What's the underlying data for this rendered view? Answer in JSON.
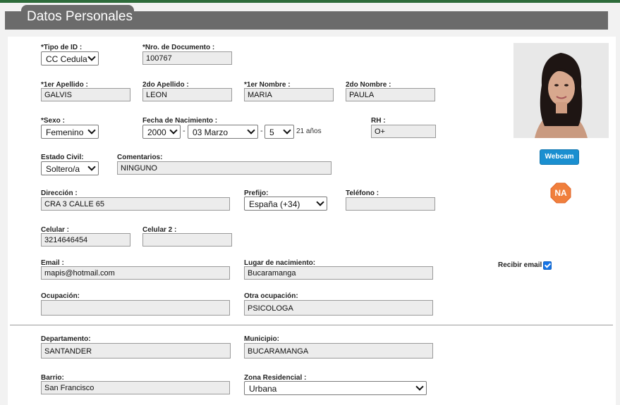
{
  "header": {
    "title": "Datos Personales"
  },
  "fields": {
    "tipo_id": {
      "label": "*Tipo de ID :",
      "value": "CC Cedula"
    },
    "nro_documento": {
      "label": "*Nro. de Documento :",
      "value": "100767"
    },
    "primer_apellido": {
      "label": "*1er Apellido :",
      "value": "GALVIS"
    },
    "segundo_apellido": {
      "label": "2do Apellido :",
      "value": "LEON"
    },
    "primer_nombre": {
      "label": "*1er Nombre :",
      "value": "MARIA"
    },
    "segundo_nombre": {
      "label": "2do Nombre :",
      "value": "PAULA"
    },
    "sexo": {
      "label": "*Sexo :",
      "value": "Femenino"
    },
    "fecha_nacimiento": {
      "label": "Fecha de Nacimiento :",
      "year": "2000",
      "month": "03 Marzo",
      "day": "5",
      "separator": "-",
      "age": "21 años"
    },
    "rh": {
      "label": "RH :",
      "value": "O+"
    },
    "estado_civil": {
      "label": "Estado Civil:",
      "value": "Soltero/a"
    },
    "comentarios": {
      "label": "Comentarios:",
      "value": "NINGUNO"
    },
    "direccion": {
      "label": "Dirección :",
      "value": "CRA 3 CALLE 65"
    },
    "prefijo": {
      "label": "Prefijo:",
      "value": "España (+34)"
    },
    "telefono": {
      "label": "Teléfono :",
      "value": ""
    },
    "celular": {
      "label": "Celular :",
      "value": "3214646454"
    },
    "celular2": {
      "label": "Celular 2 :",
      "value": ""
    },
    "email": {
      "label": "Email :",
      "value": "mapis@hotmail.com"
    },
    "lugar_nacimiento": {
      "label": "Lugar de nacimiento:",
      "value": "Bucaramanga"
    },
    "recibir_email": {
      "label": "Recibir email",
      "checked": true
    },
    "ocupacion": {
      "label": "Ocupación:",
      "value": ""
    },
    "otra_ocupacion": {
      "label": "Otra ocupación:",
      "value": "PSICOLOGA"
    },
    "departamento": {
      "label": "Departamento:",
      "value": "SANTANDER"
    },
    "municipio": {
      "label": "Municipio:",
      "value": "BUCARAMANGA"
    },
    "barrio": {
      "label": "Barrio:",
      "value": "San Francisco"
    },
    "zona_residencial": {
      "label": "Zona Residencial :",
      "value": "Urbana"
    }
  },
  "sidebar": {
    "webcam_label": "Webcam",
    "na_badge": "NA"
  },
  "colors": {
    "header_bg": "#6b6b6b",
    "top_accent": "#2d6b3a",
    "webcam_btn": "#1a8fd0",
    "na_badge": "#f07f3c",
    "checkbox": "#1473e6"
  }
}
